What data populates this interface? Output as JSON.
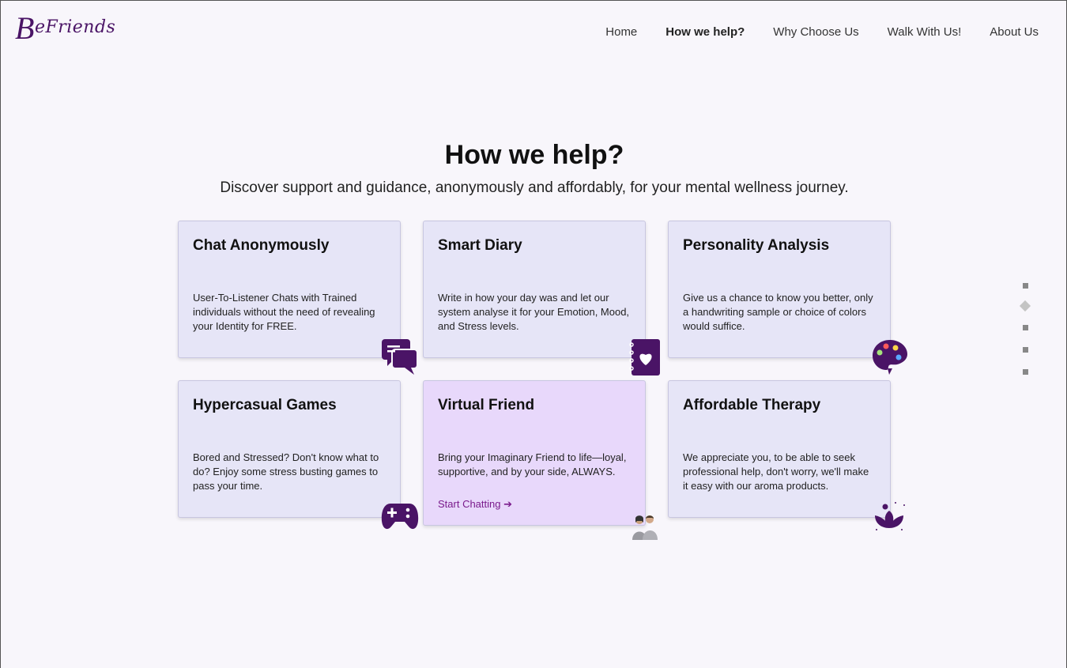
{
  "brand": {
    "logo_initial": "B",
    "logo_rest": "eFriends"
  },
  "nav": {
    "items": [
      {
        "label": "Home",
        "active": false
      },
      {
        "label": "How we help?",
        "active": true
      },
      {
        "label": "Why Choose Us",
        "active": false
      },
      {
        "label": "Walk With Us!",
        "active": false
      },
      {
        "label": "About Us",
        "active": false
      }
    ]
  },
  "section": {
    "title": "How we help?",
    "subtitle": "Discover support and guidance, anonymously and affordably, for your mental wellness journey."
  },
  "cards": [
    {
      "title": "Chat Anonymously",
      "text": "User-To-Listener Chats with Trained individuals without the need of revealing your Identity for FREE.",
      "icon": "chat-icon"
    },
    {
      "title": "Smart Diary",
      "text": "Write in how your day was and let our system analyse it for your Emotion, Mood, and Stress levels.",
      "icon": "diary-icon"
    },
    {
      "title": "Personality Analysis",
      "text": "Give us a chance to know you better, only a handwriting sample or choice of colors would suffice.",
      "icon": "palette-icon"
    },
    {
      "title": "Hypercasual Games",
      "text": "Bored and Stressed? Don't know what to do? Enjoy some stress busting games to pass your time.",
      "icon": "gamepad-icon"
    },
    {
      "title": "Virtual Friend",
      "text": "Bring your Imaginary Friend to life—loyal, supportive, and by your side, ALWAYS.",
      "link": "Start Chatting ➔",
      "icon": "friends-avatar-icon"
    },
    {
      "title": "Affordable Therapy",
      "text": "We appreciate you, to be able to seek professional help, don't worry, we'll make it easy with our aroma products.",
      "icon": "lotus-icon"
    }
  ],
  "colors": {
    "accent": "#4a1466",
    "card_bg": "#e6e5f7",
    "card_highlight_bg": "#e8d8fb",
    "link": "#7a1b8c"
  },
  "pagination": {
    "count": 5,
    "active_index": 1
  }
}
